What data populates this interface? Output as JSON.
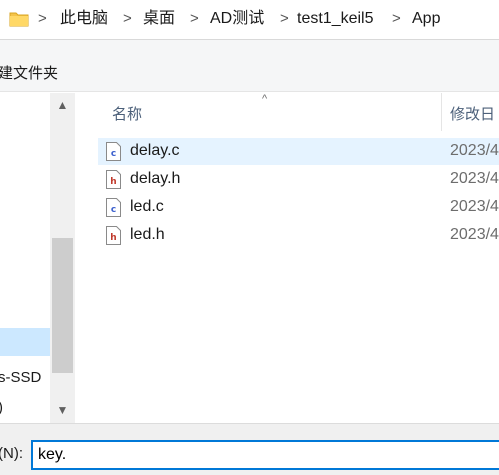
{
  "breadcrumb": {
    "items": [
      "此电脑",
      "桌面",
      "AD测试",
      "test1_keil5",
      "App"
    ],
    "separator": ">"
  },
  "toolbar": {
    "new_folder_label": "建文件夹"
  },
  "navpane": {
    "drive_label": "s-SSD",
    "partial_label": ")",
    "scroll_up_glyph": "▲",
    "scroll_down_glyph": "▼"
  },
  "filelist": {
    "columns": {
      "name": "名称",
      "date": "修改日"
    },
    "sort_glyph": "^",
    "files": [
      {
        "name": "delay.c",
        "date": "2023/4",
        "type": "c",
        "selected": true
      },
      {
        "name": "delay.h",
        "date": "2023/4",
        "type": "h",
        "selected": false
      },
      {
        "name": "led.c",
        "date": "2023/4",
        "type": "c",
        "selected": false
      },
      {
        "name": "led.h",
        "date": "2023/4",
        "type": "h",
        "selected": false
      }
    ]
  },
  "bottombar": {
    "filename_label": "(N):",
    "filename_value": "key."
  },
  "colors": {
    "selection": "#cce8ff",
    "hover_row": "#e5f3ff",
    "input_border": "#0078d7",
    "header_text": "#4c607a",
    "c_icon": "#3a5fcd",
    "h_icon": "#c0392b"
  }
}
